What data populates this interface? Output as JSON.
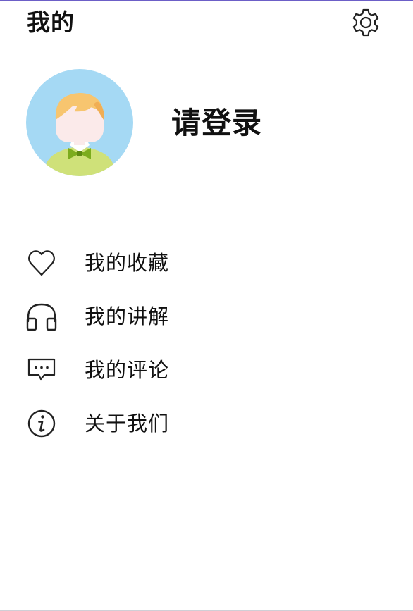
{
  "header": {
    "title": "我的",
    "settings_icon": "gear-icon"
  },
  "profile": {
    "avatar_icon": "cartoon-boy-avatar",
    "login_label": "请登录"
  },
  "menu": {
    "items": [
      {
        "label": "我的收藏",
        "icon": "heart-icon"
      },
      {
        "label": "我的讲解",
        "icon": "headphones-icon"
      },
      {
        "label": "我的评论",
        "icon": "comment-icon"
      },
      {
        "label": "关于我们",
        "icon": "info-icon"
      }
    ]
  },
  "colors": {
    "accent_top_rule": "#6c5fc7",
    "avatar_background": "#a5d9f4",
    "avatar_shirt": "#cfe179",
    "avatar_tie": "#7cac1d",
    "avatar_hair": "#f7c56f",
    "avatar_face": "#fbeaea"
  }
}
